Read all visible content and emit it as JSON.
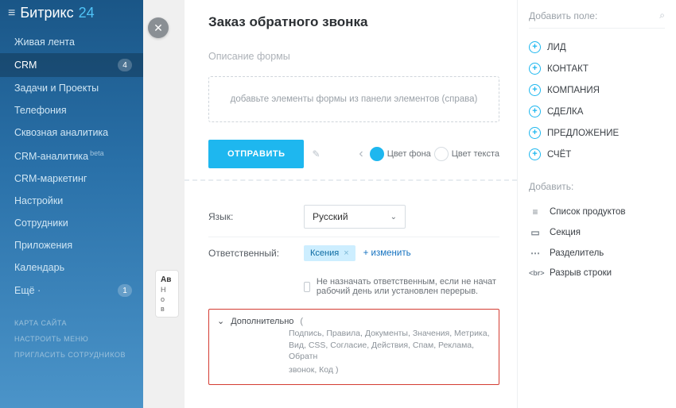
{
  "brand": {
    "name": "Битрикс",
    "suffix": "24"
  },
  "sidebar": {
    "items": [
      {
        "label": "Живая лента"
      },
      {
        "label": "CRM",
        "badge": "4",
        "active": true
      },
      {
        "label": "Задачи и Проекты"
      },
      {
        "label": "Телефония"
      },
      {
        "label": "Сквозная аналитика"
      },
      {
        "label": "CRM-аналитика",
        "beta": "beta"
      },
      {
        "label": "CRM-маркетинг"
      },
      {
        "label": "Настройки"
      },
      {
        "label": "Сотрудники"
      },
      {
        "label": "Приложения"
      },
      {
        "label": "Календарь"
      },
      {
        "label": "Ещё ·",
        "badge": "1"
      }
    ],
    "secondary": [
      "КАРТА САЙТА",
      "НАСТРОИТЬ МЕНЮ",
      "ПРИГЛАСИТЬ СОТРУДНИКОВ"
    ]
  },
  "ghost": {
    "title": "Ав",
    "l1": "Н",
    "l2": "о",
    "l3": "в"
  },
  "form": {
    "title": "Заказ обратного звонка",
    "desc": "Описание формы",
    "dropzone": "добавьте элементы формы из панели элементов (справа)",
    "submit": "ОТПРАВИТЬ",
    "bg_label": "Цвет фона",
    "text_label": "Цвет текста"
  },
  "settings": {
    "language_label": "Язык:",
    "language_value": "Русский",
    "responsible_label": "Ответственный:",
    "responsible_value": "Ксения",
    "change": "+ изменить",
    "checkbox_label": "Не назначать ответственным, если не начат рабочий день или установлен перерыв."
  },
  "additional": {
    "title": "Дополнительно",
    "open": "(",
    "sub": "Подпись, Правила, Документы, Значения, Метрика, Вид, CSS, Согласие, Действия, Спам, Реклама, Обратн",
    "sub2": "звонок, Код  )"
  },
  "rhs": {
    "add_field": "Добавить поле:",
    "fields": [
      "ЛИД",
      "КОНТАКТ",
      "КОМПАНИЯ",
      "СДЕЛКА",
      "ПРЕДЛОЖЕНИЕ",
      "СЧЁТ"
    ],
    "add_label": "Добавить:",
    "actions": [
      {
        "icon": "≡",
        "label": "Список продуктов"
      },
      {
        "icon": "▭",
        "label": "Секция"
      },
      {
        "icon": "⋯",
        "label": "Разделитель"
      },
      {
        "icon": "<br>",
        "label": "Разрыв строки"
      }
    ]
  }
}
